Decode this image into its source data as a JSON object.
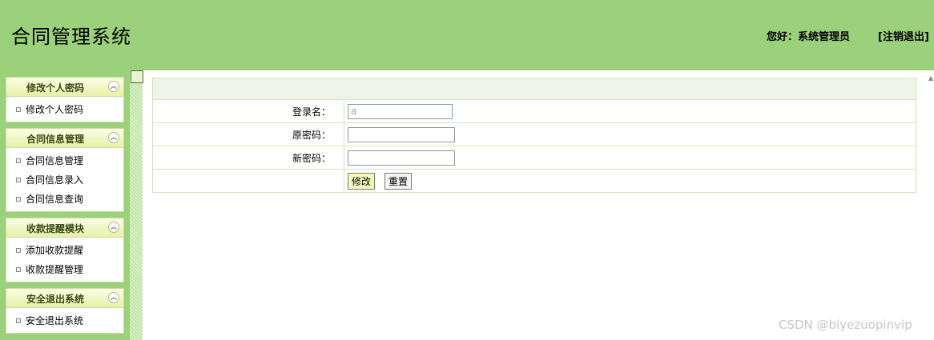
{
  "header": {
    "title": "合同管理系统",
    "greeting": "您好：系统管理员",
    "logout": "[注销退出]"
  },
  "sidebar": {
    "panels": [
      {
        "title": "修改个人密码",
        "items": [
          "修改个人密码"
        ]
      },
      {
        "title": "合同信息管理",
        "items": [
          "合同信息管理",
          "合同信息录入",
          "合同信息查询"
        ]
      },
      {
        "title": "收款提醒模块",
        "items": [
          "添加收款提醒",
          "收款提醒管理"
        ]
      },
      {
        "title": "安全退出系统",
        "items": [
          "安全退出系统"
        ]
      }
    ]
  },
  "form": {
    "username_label": "登录名：",
    "username_placeholder": "a",
    "old_password_label": "原密码：",
    "new_password_label": "新密码：",
    "submit_label": "修改",
    "reset_label": "重置"
  },
  "watermark": "CSDN @biyezuopinvip",
  "icons": {
    "collapse": "double-chevron-up-icon",
    "bullet": "square-bullet-icon"
  },
  "colors": {
    "header_bg": "#9bd17a",
    "panel_head": "#e8f1a6",
    "table_border": "#d6e3b8"
  }
}
